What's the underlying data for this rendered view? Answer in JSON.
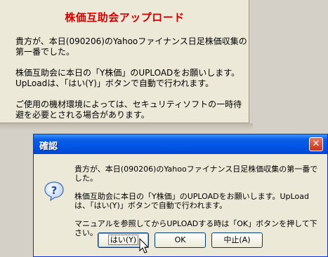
{
  "panel": {
    "title": "株価互助会アップロード",
    "paragraphs": [
      "貴方が、本日(090206)のYahooファイナンス日足株価収集の第一番でした。",
      "株価互助会に本日の「Y株価」のUPLOADをお願いします。UpLoadは、「はい(Y)」ボタンで自動で行われます。",
      "ご使用の機材環境によっては、セキュリティソフトの一時待避を必要とされる場合があります。"
    ]
  },
  "dialog": {
    "title": "確認",
    "icon": "question-icon",
    "paragraphs": [
      "貴方が、本日(090206)のYahooファイナンス日足株価収集の第一番でした。",
      "株価互助会に本日の「Y株価」のUPLOADをお願いします。UpLoadは、「はい(Y)」ボタンで自動で行われます。",
      "マニュアルを参照してからUPLOADする時は「OK」ボタンを押して下さい。"
    ],
    "buttons": {
      "yes": "はい(Y)",
      "ok": "OK",
      "cancel": "中止(A)"
    }
  },
  "colors": {
    "panel_title": "#d00000",
    "titlebar": "#0055e5",
    "close": "#c5341b"
  }
}
